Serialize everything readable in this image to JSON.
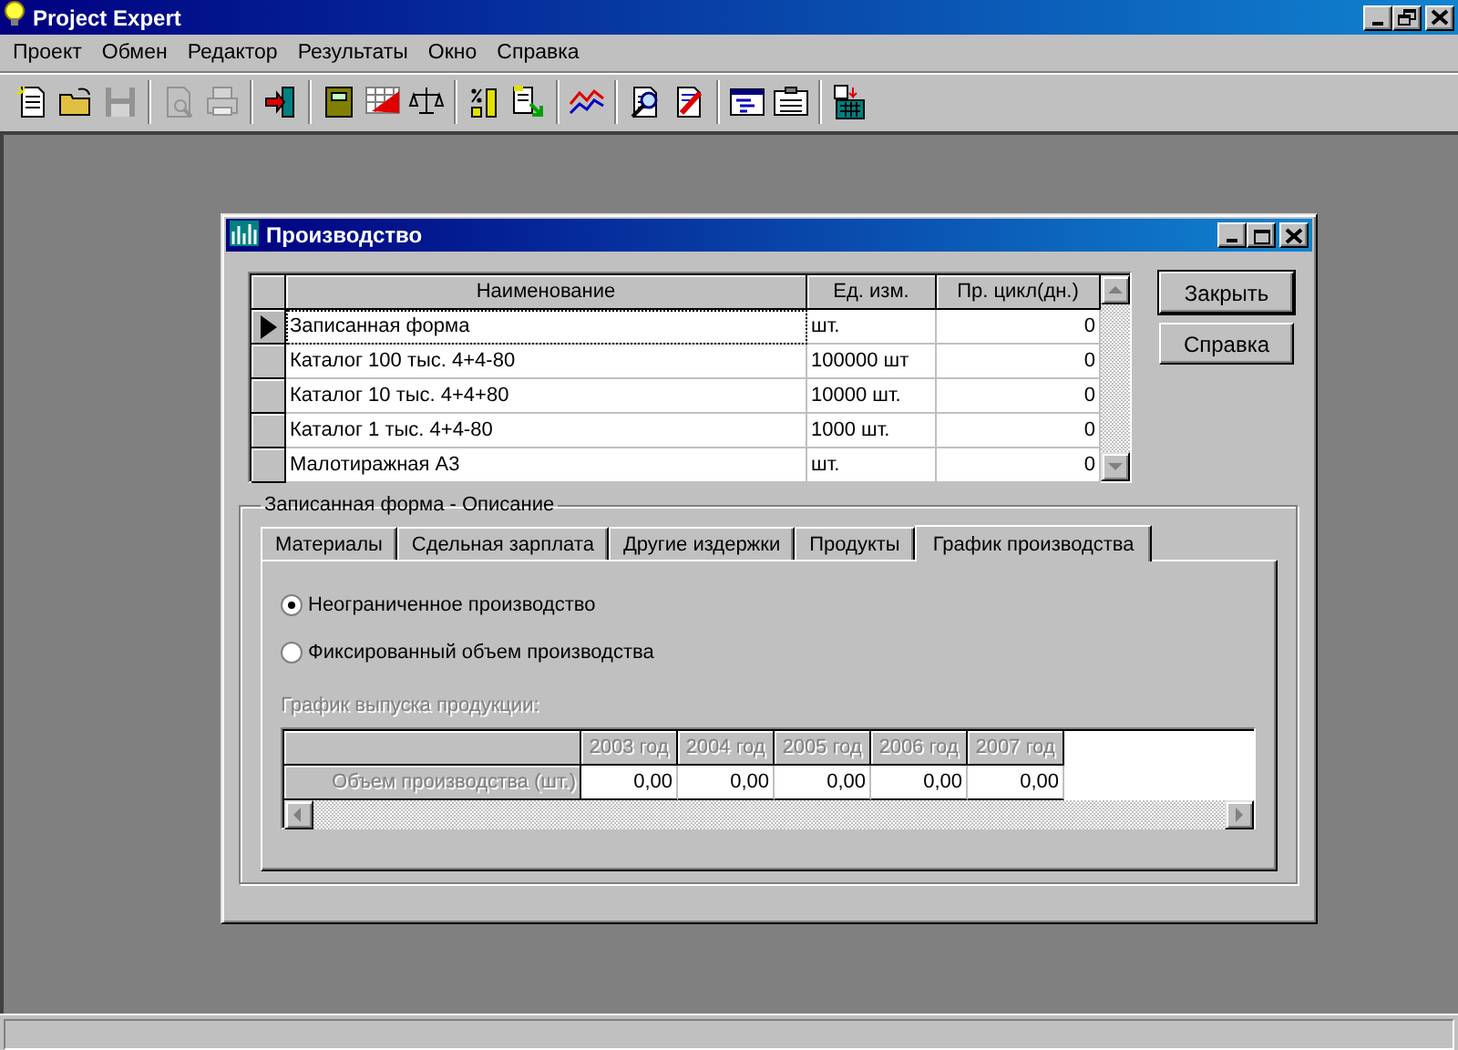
{
  "app": {
    "title": "Project Expert"
  },
  "menu": [
    {
      "label": "Проект"
    },
    {
      "label": "Обмен"
    },
    {
      "label": "Редактор"
    },
    {
      "label": "Результаты"
    },
    {
      "label": "Окно"
    },
    {
      "label": "Справка"
    }
  ],
  "toolbar": [
    {
      "kind": "new",
      "disabled": false
    },
    {
      "kind": "open",
      "disabled": false
    },
    {
      "kind": "save",
      "disabled": true
    },
    {
      "kind": "separator"
    },
    {
      "kind": "preview",
      "disabled": true
    },
    {
      "kind": "print",
      "disabled": true
    },
    {
      "kind": "separator"
    },
    {
      "kind": "exit",
      "disabled": false
    },
    {
      "kind": "separator"
    },
    {
      "kind": "notebook",
      "disabled": false
    },
    {
      "kind": "grid-chart",
      "disabled": false
    },
    {
      "kind": "scales",
      "disabled": false
    },
    {
      "kind": "separator"
    },
    {
      "kind": "ruler",
      "disabled": false
    },
    {
      "kind": "doc-arrow",
      "disabled": false
    },
    {
      "kind": "separator"
    },
    {
      "kind": "lines",
      "disabled": false
    },
    {
      "kind": "separator"
    },
    {
      "kind": "doc-search",
      "disabled": false
    },
    {
      "kind": "doc-edit",
      "disabled": false
    },
    {
      "kind": "separator"
    },
    {
      "kind": "window-list",
      "disabled": false
    },
    {
      "kind": "clipboard",
      "disabled": false
    },
    {
      "kind": "separator"
    },
    {
      "kind": "calculator",
      "disabled": false
    }
  ],
  "child_window": {
    "title": "Производство",
    "grid": {
      "columns": [
        "Наименование",
        "Ед. изм.",
        "Пр. цикл(дн.)"
      ],
      "rows": [
        {
          "cells": [
            "Записанная форма",
            "шт.",
            "0"
          ],
          "selected": true
        },
        {
          "cells": [
            "Каталог 100 тыс. 4+4-80",
            "100000 шт",
            "0"
          ],
          "selected": false
        },
        {
          "cells": [
            "Каталог 10 тыс. 4+4+80",
            "10000 шт.",
            "0"
          ],
          "selected": false
        },
        {
          "cells": [
            "Каталог 1 тыс. 4+4-80",
            "1000 шт.",
            "0"
          ],
          "selected": false
        },
        {
          "cells": [
            "Малотиражная А3",
            "шт.",
            "0"
          ],
          "selected": false
        }
      ]
    },
    "buttons": [
      "Закрыть",
      "Справка"
    ],
    "group": {
      "title": "Записанная форма - Описание",
      "tabs": [
        {
          "label": "Материалы",
          "selected": false
        },
        {
          "label": "Сдельная зарплата",
          "selected": false
        },
        {
          "label": "Другие издержки",
          "selected": false
        },
        {
          "label": "Продукты",
          "selected": false
        },
        {
          "label": "График производства",
          "selected": true
        }
      ],
      "options": [
        {
          "label": "Неограниченное производство",
          "selected": true
        },
        {
          "label": "Фиксированный объем производства",
          "selected": false
        }
      ],
      "schedule": {
        "label": "График выпуска продукции:",
        "disabled": true,
        "columns": [
          "2003 год",
          "2004 год",
          "2005 год",
          "2006 год",
          "2007 год"
        ],
        "rows": [
          {
            "label": "Объем производства (шт.)",
            "values": [
              "0,00",
              "0,00",
              "0,00",
              "0,00",
              "0,00"
            ]
          }
        ]
      }
    }
  }
}
